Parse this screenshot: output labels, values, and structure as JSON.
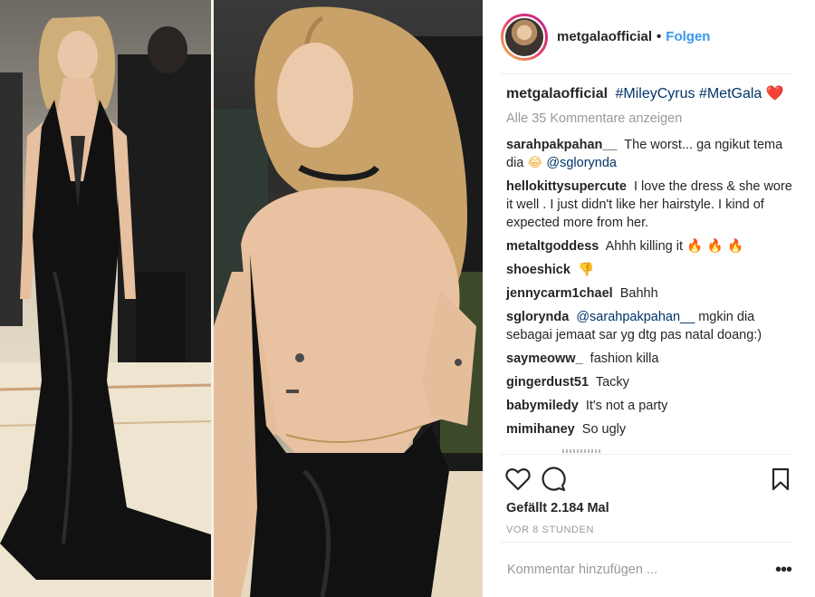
{
  "post": {
    "username": "metgalaofficial",
    "follow_label": "Folgen",
    "dot": "•",
    "caption": {
      "username": "metgalaofficial",
      "hashtag_1": "#MileyCyrus",
      "hashtag_2": "#MetGala",
      "emoji": "❤️"
    },
    "view_all_comments": "Alle 35 Kommentare anzeigen",
    "comments": [
      {
        "user": "sarahpakpahan__",
        "text": "The worst... ga ngikut tema dia",
        "emoji": "😂",
        "mention": "@sglorynda"
      },
      {
        "user": "hellokittysupercute",
        "text": "I love the dress & she wore it well . I just didn't like her hairstyle. I kind of expected more from her."
      },
      {
        "user": "metaltgoddess",
        "text": "Ahhh killing it",
        "emoji": "🔥 🔥 🔥"
      },
      {
        "user": "shoeshick",
        "text": "",
        "emoji": "👎"
      },
      {
        "user": "jennycarm1chael",
        "text": "Bahhh"
      },
      {
        "user": "sglorynda",
        "mention": "@sarahpakpahan__",
        "text": "mgkin dia sebagai jemaat sar yg dtg pas natal doang:)"
      },
      {
        "user": "saymeoww_",
        "text": "fashion killa"
      },
      {
        "user": "gingerdust51",
        "text": "Tacky"
      },
      {
        "user": "babymiledy",
        "text": "It's not a party"
      },
      {
        "user": "mimihaney",
        "text": "So ugly"
      }
    ],
    "likes": "Gefällt 2.184 Mal",
    "timestamp": "VOR 8 STUNDEN",
    "comment_placeholder": "Kommentar hinzufügen ...",
    "options_glyph": "•••",
    "icons": {
      "like": "heart-icon",
      "comment": "comment-bubble-icon",
      "save": "bookmark-icon",
      "options": "more-options-icon"
    },
    "colors": {
      "link": "#003569",
      "follow": "#3897f0",
      "muted": "#999999",
      "text": "#262626"
    }
  }
}
